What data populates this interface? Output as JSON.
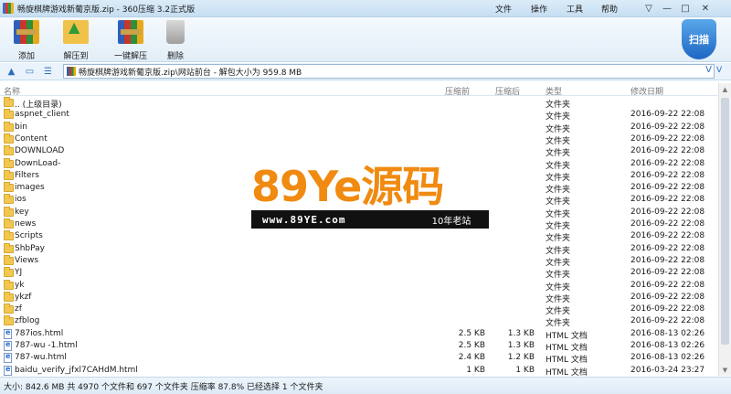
{
  "window": {
    "title": "畅旋棋牌游戏新葡京版.zip - 360压缩 3.2正式版",
    "menu": [
      "文件",
      "操作",
      "工具",
      "帮助"
    ],
    "controls": [
      "▽",
      "—",
      "□",
      "✕"
    ]
  },
  "toolbar": {
    "buttons": [
      {
        "label": "添加",
        "icon": "add-archive-icon"
      },
      {
        "label": "解压到",
        "icon": "extract-to-icon"
      },
      {
        "label": "一键解压",
        "icon": "one-click-extract-icon"
      },
      {
        "label": "删除",
        "icon": "trash-icon"
      }
    ],
    "scan_label": "扫描"
  },
  "address": {
    "path": "畅旋棋牌游戏新葡京版.zip\\网站前台 - 解包大小为 959.8 MB",
    "dropdown": "V",
    "go": "V"
  },
  "columns": {
    "name": "名称",
    "compressed": "压缩前",
    "packed": "压缩后",
    "type": "类型",
    "modified": "修改日期"
  },
  "rows": [
    {
      "name": ".. (上级目录)",
      "size": "",
      "packed": "",
      "type": "文件夹",
      "date": "",
      "kind": "folder"
    },
    {
      "name": "aspnet_client",
      "size": "",
      "packed": "",
      "type": "文件夹",
      "date": "2016-09-22 22:08",
      "kind": "folder"
    },
    {
      "name": "bin",
      "size": "",
      "packed": "",
      "type": "文件夹",
      "date": "2016-09-22 22:08",
      "kind": "folder"
    },
    {
      "name": "Content",
      "size": "",
      "packed": "",
      "type": "文件夹",
      "date": "2016-09-22 22:08",
      "kind": "folder"
    },
    {
      "name": "DOWNLOAD",
      "size": "",
      "packed": "",
      "type": "文件夹",
      "date": "2016-09-22 22:08",
      "kind": "folder"
    },
    {
      "name": "DownLoad-",
      "size": "",
      "packed": "",
      "type": "文件夹",
      "date": "2016-09-22 22:08",
      "kind": "folder"
    },
    {
      "name": "Filters",
      "size": "",
      "packed": "",
      "type": "文件夹",
      "date": "2016-09-22 22:08",
      "kind": "folder"
    },
    {
      "name": "images",
      "size": "",
      "packed": "",
      "type": "文件夹",
      "date": "2016-09-22 22:08",
      "kind": "folder"
    },
    {
      "name": "ios",
      "size": "",
      "packed": "",
      "type": "文件夹",
      "date": "2016-09-22 22:08",
      "kind": "folder"
    },
    {
      "name": "key",
      "size": "",
      "packed": "",
      "type": "文件夹",
      "date": "2016-09-22 22:08",
      "kind": "folder"
    },
    {
      "name": "news",
      "size": "",
      "packed": "",
      "type": "文件夹",
      "date": "2016-09-22 22:08",
      "kind": "folder"
    },
    {
      "name": "Scripts",
      "size": "",
      "packed": "",
      "type": "文件夹",
      "date": "2016-09-22 22:08",
      "kind": "folder"
    },
    {
      "name": "ShbPay",
      "size": "",
      "packed": "",
      "type": "文件夹",
      "date": "2016-09-22 22:08",
      "kind": "folder"
    },
    {
      "name": "Views",
      "size": "",
      "packed": "",
      "type": "文件夹",
      "date": "2016-09-22 22:08",
      "kind": "folder"
    },
    {
      "name": "YJ",
      "size": "",
      "packed": "",
      "type": "文件夹",
      "date": "2016-09-22 22:08",
      "kind": "folder"
    },
    {
      "name": "yk",
      "size": "",
      "packed": "",
      "type": "文件夹",
      "date": "2016-09-22 22:08",
      "kind": "folder"
    },
    {
      "name": "ykzf",
      "size": "",
      "packed": "",
      "type": "文件夹",
      "date": "2016-09-22 22:08",
      "kind": "folder"
    },
    {
      "name": "zf",
      "size": "",
      "packed": "",
      "type": "文件夹",
      "date": "2016-09-22 22:08",
      "kind": "folder"
    },
    {
      "name": "zfblog",
      "size": "",
      "packed": "",
      "type": "文件夹",
      "date": "2016-09-22 22:08",
      "kind": "folder"
    },
    {
      "name": "787ios.html",
      "size": "2.5 KB",
      "packed": "1.3 KB",
      "type": "HTML 文档",
      "date": "2016-08-13 02:26",
      "kind": "html"
    },
    {
      "name": "787-wu -1.html",
      "size": "2.5 KB",
      "packed": "1.3 KB",
      "type": "HTML 文档",
      "date": "2016-08-13 02:26",
      "kind": "html"
    },
    {
      "name": "787-wu.html",
      "size": "2.4 KB",
      "packed": "1.2 KB",
      "type": "HTML 文档",
      "date": "2016-08-13 02:26",
      "kind": "html"
    },
    {
      "name": "baidu_verify_jfxl7CAHdM.html",
      "size": "1 KB",
      "packed": "1 KB",
      "type": "HTML 文档",
      "date": "2016-03-24 23:27",
      "kind": "html"
    }
  ],
  "watermark": {
    "brand": "89Ye源码",
    "url": "www.89YE.com",
    "age": "10年老站"
  },
  "status": "大小: 842.6 MB 共 4970 个文件和 697 个文件夹 压缩率 87.8% 已经选择 1 个文件夹",
  "colors": {
    "accent": "#2c6fc2",
    "watermark_orange": "#f08a10",
    "selection": "#cfe4f7"
  }
}
